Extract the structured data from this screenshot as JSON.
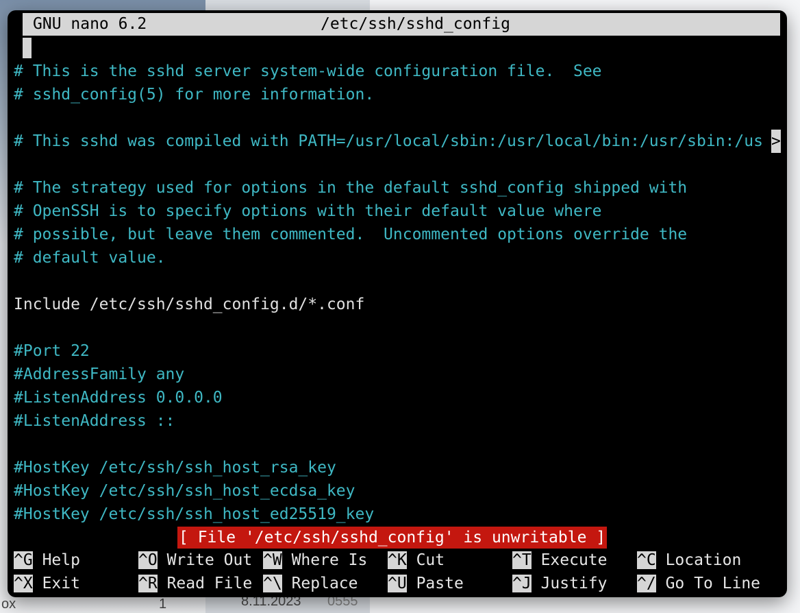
{
  "background": {
    "left_text_1": "ox",
    "left_text_2": "1",
    "date_text": "8.11.2023",
    "time_text": "0555"
  },
  "terminal": {
    "app_name": "GNU nano 6.2",
    "file_path": "/etc/ssh/sshd_config",
    "lines": [
      {
        "text": "# This is the sshd server system-wide configuration file.  See",
        "color": "cyan"
      },
      {
        "text": "# sshd_config(5) for more information.",
        "color": "cyan"
      },
      {
        "text": "",
        "color": "cyan"
      },
      {
        "text": "# This sshd was compiled with PATH=/usr/local/sbin:/usr/local/bin:/usr/sbin:/us",
        "color": "cyan"
      },
      {
        "text": "",
        "color": "cyan"
      },
      {
        "text": "# The strategy used for options in the default sshd_config shipped with",
        "color": "cyan"
      },
      {
        "text": "# OpenSSH is to specify options with their default value where",
        "color": "cyan"
      },
      {
        "text": "# possible, but leave them commented.  Uncommented options override the",
        "color": "cyan"
      },
      {
        "text": "# default value.",
        "color": "cyan"
      },
      {
        "text": "",
        "color": "cyan"
      },
      {
        "text": "Include /etc/ssh/sshd_config.d/*.conf",
        "color": "white"
      },
      {
        "text": "",
        "color": "cyan"
      },
      {
        "text": "#Port 22",
        "color": "cyan"
      },
      {
        "text": "#AddressFamily any",
        "color": "cyan"
      },
      {
        "text": "#ListenAddress 0.0.0.0",
        "color": "cyan"
      },
      {
        "text": "#ListenAddress ::",
        "color": "cyan"
      },
      {
        "text": "",
        "color": "cyan"
      },
      {
        "text": "#HostKey /etc/ssh/ssh_host_rsa_key",
        "color": "cyan"
      },
      {
        "text": "#HostKey /etc/ssh/ssh_host_ecdsa_key",
        "color": "cyan"
      },
      {
        "text": "#HostKey /etc/ssh/ssh_host_ed25519_key",
        "color": "cyan"
      }
    ],
    "overflow_marker": ">",
    "status_message": "[ File '/etc/ssh/sshd_config' is unwritable ]",
    "shortcuts": [
      {
        "key": "^G",
        "label": "Help"
      },
      {
        "key": "^O",
        "label": "Write Out"
      },
      {
        "key": "^W",
        "label": "Where Is"
      },
      {
        "key": "^K",
        "label": "Cut"
      },
      {
        "key": "^T",
        "label": "Execute"
      },
      {
        "key": "^C",
        "label": "Location"
      },
      {
        "key": "^X",
        "label": "Exit"
      },
      {
        "key": "^R",
        "label": "Read File"
      },
      {
        "key": "^\\",
        "label": "Replace"
      },
      {
        "key": "^U",
        "label": "Paste"
      },
      {
        "key": "^J",
        "label": "Justify"
      },
      {
        "key": "^/",
        "label": "Go To Line"
      }
    ],
    "colors": {
      "cyan": "#3fb8c4",
      "white": "#e0e0e0",
      "status_bg": "#c4170f",
      "bar_bg": "#d6d6d6"
    }
  }
}
